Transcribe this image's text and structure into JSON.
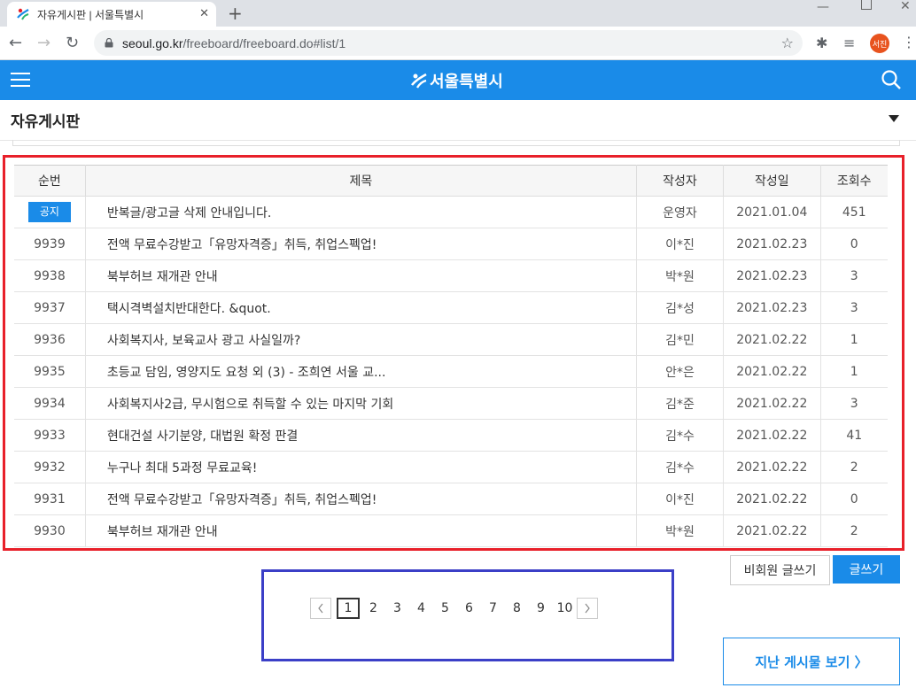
{
  "browser": {
    "tab_title": "자유게시판 | 서울특별시",
    "url_host": "seoul.go.kr",
    "url_path": "/freeboard/freeboard.do#list/1",
    "profile_label": "서진"
  },
  "site": {
    "logo_text": "서울특별시",
    "brand_color": "#1a8be8"
  },
  "board": {
    "title": "자유게시판",
    "columns": [
      "순번",
      "제목",
      "작성자",
      "작성일",
      "조회수"
    ],
    "rows": [
      {
        "no": "공지",
        "title": "반복글/광고글 삭제 안내입니다.",
        "author": "운영자",
        "date": "2021.01.04",
        "views": "451"
      },
      {
        "no": "9939",
        "title": "전액 무료수강받고「유망자격증」취득, 취업스펙업!",
        "author": "이*진",
        "date": "2021.02.23",
        "views": "0"
      },
      {
        "no": "9938",
        "title": "북부허브 재개관 안내",
        "author": "박*원",
        "date": "2021.02.23",
        "views": "3"
      },
      {
        "no": "9937",
        "title": "택시격벽설치반대한다. &quot.",
        "author": "김*성",
        "date": "2021.02.23",
        "views": "3"
      },
      {
        "no": "9936",
        "title": "사회복지사, 보육교사 광고 사실일까?",
        "author": "김*민",
        "date": "2021.02.22",
        "views": "1"
      },
      {
        "no": "9935",
        "title": "초등교 담임, 영양지도 요청 외 (3) - 조희연 서울 교...",
        "author": "안*은",
        "date": "2021.02.22",
        "views": "1"
      },
      {
        "no": "9934",
        "title": "사회복지사2급, 무시험으로 취득할 수 있는 마지막 기회",
        "author": "김*준",
        "date": "2021.02.22",
        "views": "3"
      },
      {
        "no": "9933",
        "title": "현대건설 사기분양, 대법원 확정 판결",
        "author": "김*수",
        "date": "2021.02.22",
        "views": "41"
      },
      {
        "no": "9932",
        "title": "누구나 최대 5과정 무료교육!",
        "author": "김*수",
        "date": "2021.02.22",
        "views": "2"
      },
      {
        "no": "9931",
        "title": "전액 무료수강받고「유망자격증」취득, 취업스펙업!",
        "author": "이*진",
        "date": "2021.02.22",
        "views": "0"
      },
      {
        "no": "9930",
        "title": "북부허브 재개관 안내",
        "author": "박*원",
        "date": "2021.02.22",
        "views": "2"
      }
    ],
    "guest_write_label": "비회원 글쓰기",
    "write_label": "글쓰기",
    "past_posts_label": "지난 게시물 보기 〉"
  },
  "pagination": {
    "pages": [
      "1",
      "2",
      "3",
      "4",
      "5",
      "6",
      "7",
      "8",
      "9",
      "10"
    ],
    "current": "1"
  }
}
